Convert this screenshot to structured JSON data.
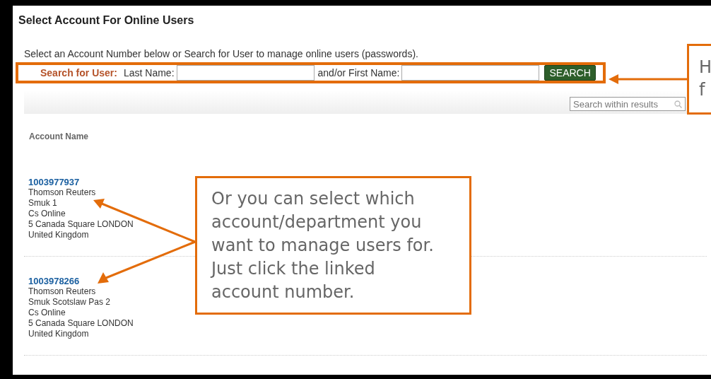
{
  "page": {
    "title": "Select Account For Online Users",
    "description": "Select an Account Number below or Search for User to manage online users (passwords)."
  },
  "search": {
    "label": "Search for User:",
    "last_name_label": "Last Name:",
    "first_name_label": "and/or First Name:",
    "button": "SEARCH"
  },
  "filter": {
    "placeholder": "Search within results"
  },
  "table": {
    "columns": [
      "Account Name"
    ],
    "rows": [
      {
        "account_number": "1003977937",
        "lines": [
          "Thomson Reuters",
          "Smuk 1",
          "Cs Online",
          "5 Canada Square LONDON",
          "United Kingdom"
        ]
      },
      {
        "account_number": "1003978266",
        "lines": [
          "Thomson Reuters",
          "Smuk Scotslaw Pas 2",
          "Cs Online",
          "5 Canada Square LONDON",
          "United Kingdom"
        ]
      }
    ]
  },
  "callouts": [
    {
      "kind": "main",
      "lines": [
        "Or you can select which",
        "account/department you",
        "want to manage users for.",
        "Just click the linked",
        "account number."
      ]
    },
    {
      "kind": "edge",
      "lines": [
        "H",
        "f"
      ]
    }
  ]
}
